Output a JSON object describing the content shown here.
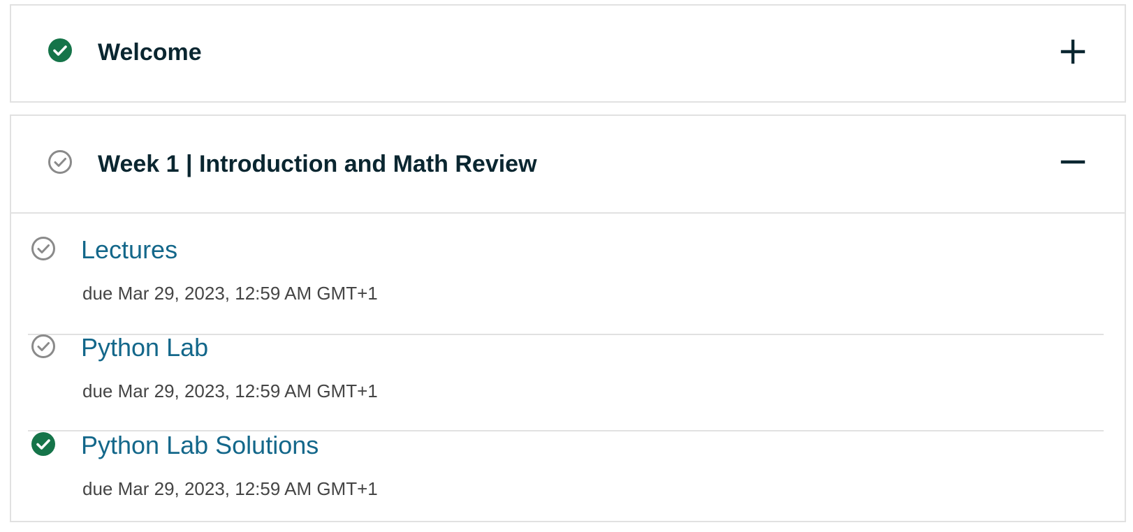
{
  "colors": {
    "complete": "#157449",
    "incomplete": "#8a8a8a",
    "title": "#0a2630",
    "link": "#13678a",
    "due": "#454545",
    "border": "#e1e1e1"
  },
  "sections": [
    {
      "title": "Welcome",
      "status_icon": "check-circle-filled-icon",
      "completed": true,
      "expanded": false,
      "toggle_icon": "plus-icon"
    },
    {
      "title": "Week 1 | Introduction and Math Review",
      "status_icon": "check-circle-outline-icon",
      "completed": false,
      "expanded": true,
      "toggle_icon": "minus-icon",
      "units": [
        {
          "title": "Lectures",
          "due": "due Mar 29, 2023, 12:59 AM GMT+1",
          "completed": false,
          "status_icon": "check-circle-outline-icon"
        },
        {
          "title": "Python Lab",
          "due": "due Mar 29, 2023, 12:59 AM GMT+1",
          "completed": false,
          "status_icon": "check-circle-outline-icon"
        },
        {
          "title": "Python Lab Solutions",
          "due": "due Mar 29, 2023, 12:59 AM GMT+1",
          "completed": true,
          "status_icon": "check-circle-filled-icon"
        }
      ]
    }
  ]
}
